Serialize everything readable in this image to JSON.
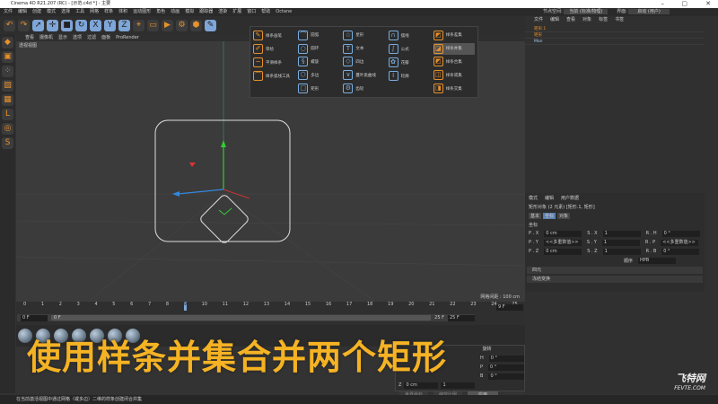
{
  "window": {
    "title": "Cinema 4D R21.207 (RC) - [示范.c4d *] - 主要",
    "min": "–",
    "max": "▢",
    "close": "✕"
  },
  "menu": [
    "文件",
    "编辑",
    "创建",
    "模式",
    "选择",
    "工具",
    "网格",
    "样条",
    "体积",
    "运动图形",
    "角色",
    "动画",
    "模拟",
    "跟踪器",
    "渲染",
    "扩展",
    "窗口",
    "帮助",
    "Octane"
  ],
  "toolbar": {
    "icons": [
      "undo-icon",
      "redo-icon",
      "select-icon",
      "move-icon",
      "scale-icon",
      "rotate-icon",
      "x-axis-icon",
      "y-axis-icon",
      "z-axis-icon",
      "coord-icon",
      "render-view-icon",
      "render-icon",
      "render-settings-icon",
      "cube-icon",
      "spline-pen-icon"
    ],
    "glyphs": [
      "↶",
      "↷",
      "➚",
      "✛",
      "■",
      "↻",
      "X",
      "Y",
      "Z",
      "⌖",
      "▭",
      "▶",
      "⚙",
      "⬢",
      "✎"
    ]
  },
  "viewport": {
    "menu": [
      "查看",
      "摄像机",
      "显示",
      "选项",
      "过滤",
      "面板",
      "ProRender"
    ],
    "name": "透视视图",
    "grid": "网格间距 : 100 cm"
  },
  "spline_menu": {
    "columns": [
      [
        {
          "label": "样条画笔",
          "g": "✎"
        },
        {
          "label": "草绘",
          "g": "✐"
        },
        {
          "label": "平滑样条",
          "g": "~"
        },
        {
          "label": "样条弧线工具",
          "g": "⌒"
        }
      ],
      [
        {
          "label": "圆弧",
          "g": "⌒"
        },
        {
          "label": "圆环",
          "g": "○"
        },
        {
          "label": "螺旋",
          "g": "§"
        },
        {
          "label": "多边",
          "g": "⬡"
        },
        {
          "label": "矩形",
          "g": "□"
        }
      ],
      [
        {
          "label": "星形",
          "g": "☆"
        },
        {
          "label": "文本",
          "g": "T"
        },
        {
          "label": "四边",
          "g": "◇"
        },
        {
          "label": "蔓叶类曲线",
          "g": "∨"
        },
        {
          "label": "齿轮",
          "g": "⚙"
        }
      ],
      [
        {
          "label": "摆线",
          "g": "∩"
        },
        {
          "label": "公式",
          "g": "∫"
        },
        {
          "label": "花瓣",
          "g": "✿"
        },
        {
          "label": "轮廓",
          "g": "I"
        }
      ],
      [
        {
          "label": "样条差集",
          "g": "◩"
        },
        {
          "label": "样条并集",
          "g": "◪"
        },
        {
          "label": "样条合集",
          "g": "◩"
        },
        {
          "label": "样条或集",
          "g": "◫"
        },
        {
          "label": "样条交集",
          "g": "◨"
        }
      ]
    ],
    "highlighted": "样条并集"
  },
  "right": {
    "node_space_label": "节点空间:",
    "node_space": "当前 (标准/物理)",
    "layout_label": "界面:",
    "layout": "启动 (用户)",
    "om_menu": [
      "文件",
      "编辑",
      "查看",
      "对象",
      "标签",
      "书签"
    ],
    "objects": [
      {
        "name": "矩形.1",
        "color": "#e8912c"
      },
      {
        "name": "矩形",
        "color": "#e8912c"
      },
      {
        "name": "Man",
        "color": "#aaccee"
      }
    ]
  },
  "attributes": {
    "menu": [
      "模式",
      "编辑",
      "用户数据"
    ],
    "title": "矩形对象 (2 元素) [矩形.1, 矩形]",
    "tabs": [
      "基本",
      "坐标",
      "对象"
    ],
    "section": "坐标",
    "rows": [
      [
        "P . X",
        "0 cm",
        "S . X",
        "1",
        "R . H",
        "0 °"
      ],
      [
        "P . Y",
        "<<多重数值>>",
        "S . Y",
        "1",
        "R . P",
        "<<多重数值>>"
      ],
      [
        "P . Z",
        "0 cm",
        "S . Z",
        "1",
        "R . B",
        "0 °"
      ]
    ],
    "order_label": "顺序",
    "order": "HPB",
    "groups": [
      "四元",
      "冻结变换"
    ]
  },
  "timeline": {
    "ticks": [
      "0",
      "1",
      "2",
      "3",
      "4",
      "5",
      "6",
      "7",
      "8",
      "9",
      "10",
      "11",
      "12",
      "13",
      "14",
      "15",
      "16",
      "17",
      "18",
      "19",
      "20",
      "21",
      "22",
      "23",
      "24",
      "25"
    ],
    "current": "9 F",
    "start": "0 F",
    "range_start": "0 F",
    "range_end": "25 F",
    "end": "25 F",
    "current_frame": 9,
    "total_frames": 25
  },
  "coordinates": {
    "header": "旋转",
    "rows": [
      [
        "H",
        "0 °"
      ],
      [
        "P",
        "0 °"
      ],
      [
        "B",
        "0 °"
      ]
    ],
    "z_label": "Z",
    "z_pos": "0 cm",
    "z_scale": "1",
    "mode1": "世界坐标",
    "mode2": "缩放比例",
    "apply": "应用"
  },
  "caption": "使用样条并集合并两个矩形",
  "status": "在当前激活视图中通过网格（或多边）二维的样条创建闭合并集",
  "watermark": {
    "cn": "飞特网",
    "en": "FEVTE.COM"
  }
}
